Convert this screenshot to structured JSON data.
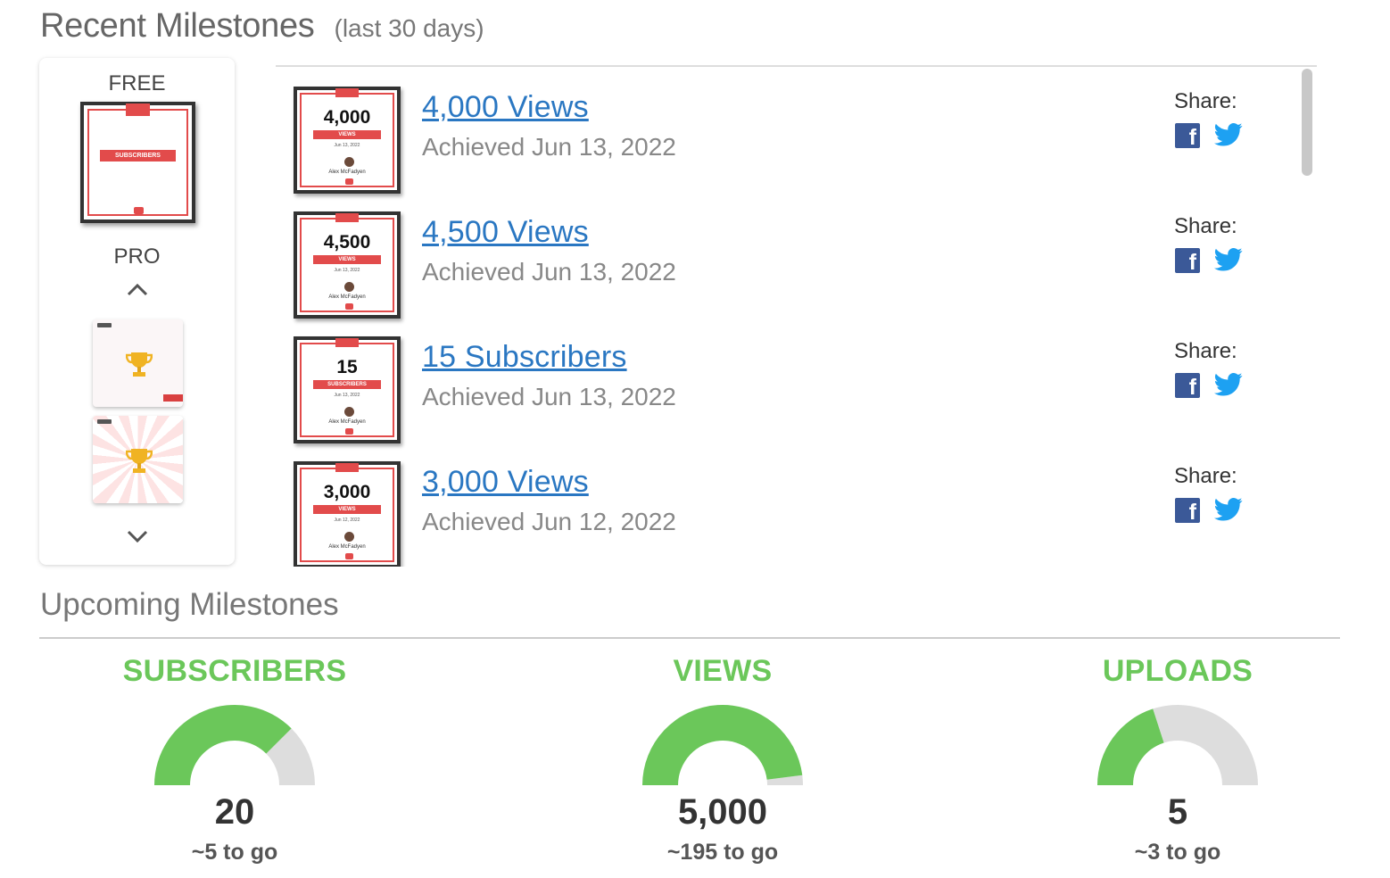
{
  "recent": {
    "title": "Recent Milestones",
    "subtitle": "(last 30 days)"
  },
  "sidebar": {
    "free_label": "FREE",
    "pro_label": "PRO",
    "free_thumb_band": "SUBSCRIBERS"
  },
  "milestones": [
    {
      "number": "4,000",
      "band": "VIEWS",
      "badge_date": "Jun 13, 2022",
      "creator": "Alex McFadyen",
      "title": "4,000 Views",
      "achieved": "Achieved Jun 13, 2022",
      "share_label": "Share:"
    },
    {
      "number": "4,500",
      "band": "VIEWS",
      "badge_date": "Jun 13, 2022",
      "creator": "Alex McFadyen",
      "title": "4,500 Views",
      "achieved": "Achieved Jun 13, 2022",
      "share_label": "Share:"
    },
    {
      "number": "15",
      "band": "SUBSCRIBERS",
      "badge_date": "Jun 13, 2022",
      "creator": "Alex McFadyen",
      "title": "15 Subscribers",
      "achieved": "Achieved Jun 13, 2022",
      "share_label": "Share:"
    },
    {
      "number": "3,000",
      "band": "VIEWS",
      "badge_date": "Jun 12, 2022",
      "creator": "Alex McFadyen",
      "title": "3,000 Views",
      "achieved": "Achieved Jun 12, 2022",
      "share_label": "Share:"
    }
  ],
  "upcoming": {
    "title": "Upcoming Milestones",
    "gauges": [
      {
        "label": "SUBSCRIBERS",
        "value": "20",
        "to_go": "~5 to go",
        "progress": 0.75
      },
      {
        "label": "VIEWS",
        "value": "5,000",
        "to_go": "~195 to go",
        "progress": 0.96
      },
      {
        "label": "UPLOADS",
        "value": "5",
        "to_go": "~3 to go",
        "progress": 0.4
      }
    ]
  },
  "colors": {
    "accent_green": "#6bc75a",
    "link_blue": "#2a77c2",
    "badge_red": "#e24b4b",
    "gauge_track": "#dddddd",
    "facebook": "#3b5998",
    "twitter": "#1da1f2"
  },
  "icons": {
    "share_icons": [
      "facebook-icon",
      "twitter-icon"
    ],
    "sidebar_nav": [
      "chevron-up-icon",
      "chevron-down-icon"
    ],
    "pro_thumb_icon": "trophy-icon"
  }
}
